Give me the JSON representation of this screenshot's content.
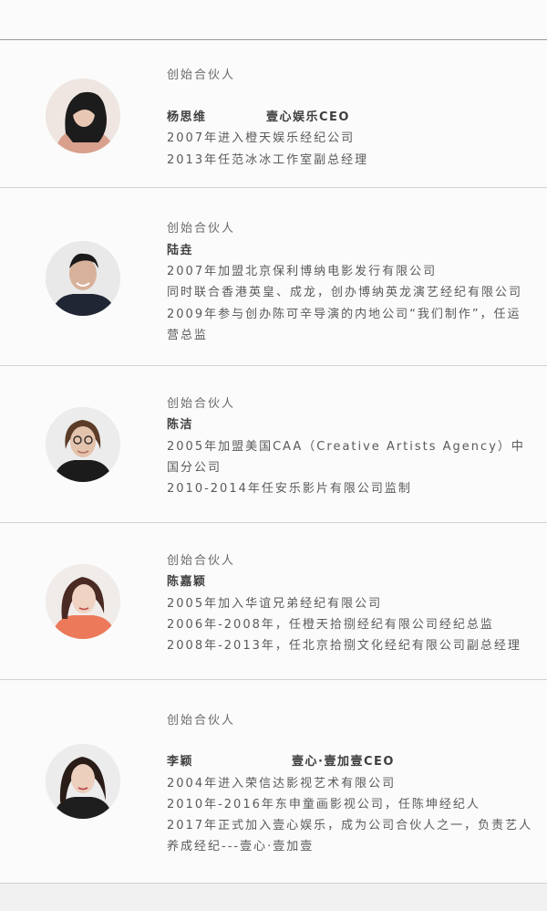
{
  "cards": [
    {
      "role": "创始合伙人",
      "name": "杨思维",
      "title_right": "壹心娱乐CEO",
      "lines": [
        "2007年进入橙天娱乐经纪公司",
        "2013年任范冰冰工作室副总经理"
      ]
    },
    {
      "role": "创始合伙人",
      "name": "陆垚",
      "lines": [
        "2007年加盟北京保利博纳电影发行有限公司",
        "同时联合香港英皇、成龙，创办博纳英龙演艺经纪有限公司",
        "2009年参与创办陈可辛导演的内地公司“我们制作”，任运",
        "营总监"
      ]
    },
    {
      "role": "创始合伙人",
      "name": "陈洁",
      "lines": [
        "2005年加盟美国CAA（Creative Artists Agency）中",
        "国分公司",
        "2010-2014年任安乐影片有限公司监制"
      ]
    },
    {
      "role": "创始合伙人",
      "name": "陈嘉颖",
      "lines": [
        "2005年加入华谊兄弟经纪有限公司",
        "2006年-2008年，任橙天拾捌经纪有限公司经纪总监",
        "2008年-2013年，任北京拾捌文化经纪有限公司副总经理"
      ]
    },
    {
      "role": "创始合伙人",
      "name": "李颖",
      "title_right": "壹心·壹加壹CEO",
      "lines": [
        "2004年进入荣信达影视艺术有限公司",
        "2010年-2016年东申童画影视公司，任陈坤经纪人",
        "2017年正式加入壹心娱乐，成为公司合伙人之一，负责艺人",
        "养成经纪---壹心·壹加壹"
      ]
    }
  ]
}
